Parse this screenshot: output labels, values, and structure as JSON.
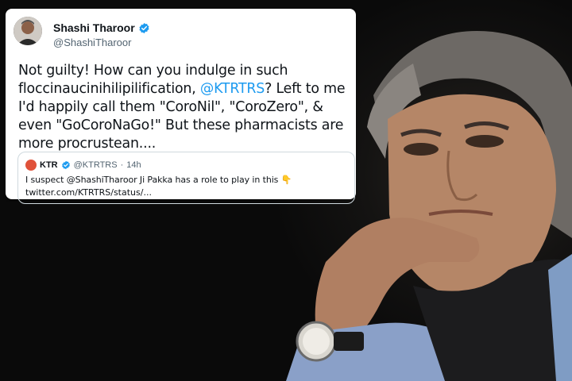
{
  "tweet": {
    "author_name": "Shashi Tharoor",
    "author_handle": "@ShashiTharoor",
    "verified_icon": "verified-badge-icon",
    "accent_color": "#1d9bf0",
    "body_part1": "Not guilty! How can you indulge in such floccinaucinihilipilification, ",
    "body_mention": "@KTRTRS",
    "body_part2": "? Left to me I'd happily call them \"CoroNil\", \"CoroZero\", & even \"GoCoroNaGo!\" But these pharmacists are more procrustean....",
    "quote": {
      "author_name": "KTR",
      "author_handle": "@KTRTRS",
      "separator": "·",
      "time": "14h",
      "text": "I suspect @ShashiTharoor Ji Pakka has a role to play in this",
      "emoji": "👇",
      "link": "twitter.com/KTRTRS/status/..."
    }
  }
}
